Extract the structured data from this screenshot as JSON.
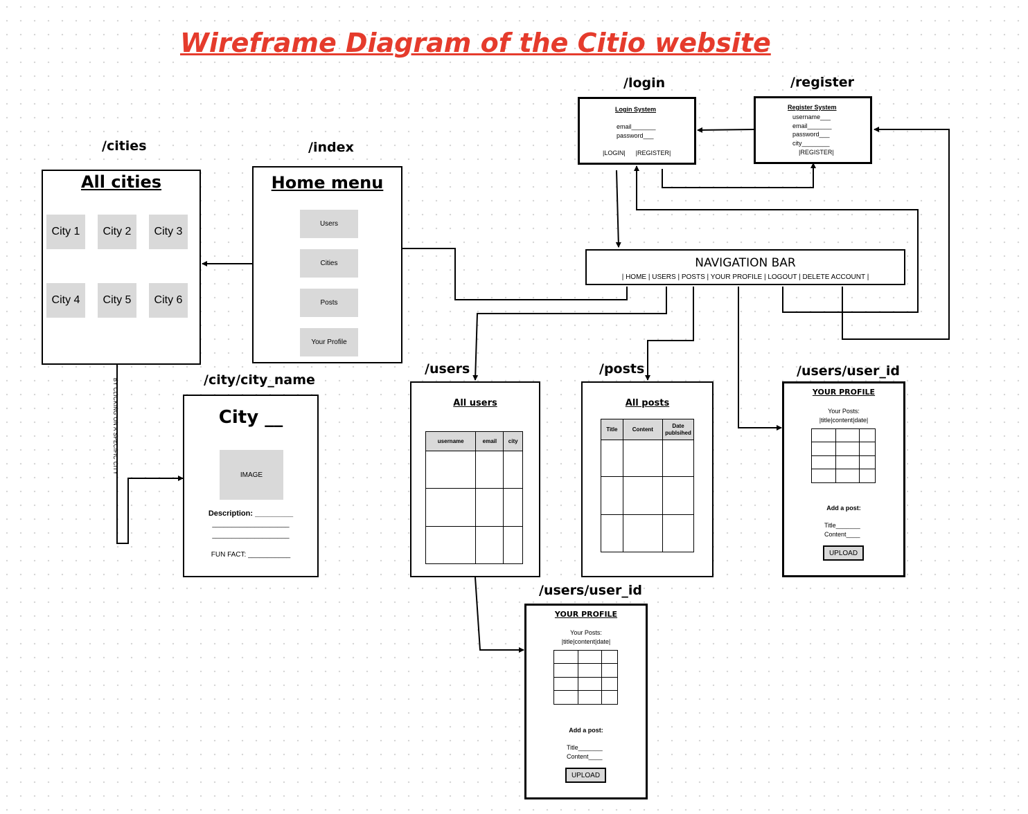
{
  "title": "Wireframe Diagram of the Citio website",
  "routes": {
    "cities": "/cities",
    "index": "/index",
    "login": "/login",
    "register": "/register",
    "city": "/city/city_name",
    "users": "/users",
    "posts": "/posts",
    "user_profile": "/users/user_id",
    "user_profile_2": "/users/user_id"
  },
  "cities_page": {
    "heading": "All cities",
    "tiles": [
      "City 1",
      "City 2",
      "City 3",
      "City 4",
      "City 5",
      "City 6"
    ]
  },
  "home_menu": {
    "heading": "Home menu",
    "buttons": [
      "Users",
      "Cities",
      "Posts",
      "Your Profile"
    ]
  },
  "login": {
    "heading": "Login System",
    "email": "email_______",
    "password": "password___",
    "links": "|LOGIN|      |REGISTER|"
  },
  "register": {
    "heading": "Register System",
    "username": "username___",
    "email": "email_______",
    "password": "password___",
    "city": "city________",
    "link": "|REGISTER|"
  },
  "nav_bar": {
    "heading": "NAVIGATION BAR",
    "items": "| HOME | USERS | POSTS | YOUR PROFILE | LOGOUT | DELETE ACCOUNT |"
  },
  "city_page": {
    "heading": "City __",
    "image": "IMAGE",
    "description": "Description: _________",
    "desc_line_1": "____________________",
    "desc_line_2": "____________________",
    "fun_fact": "FUN FACT: ___________"
  },
  "annotation": "BY CLICKING ON A SPECIFIC CITY",
  "users_page": {
    "heading": "All users",
    "columns": [
      "username",
      "email",
      "city"
    ]
  },
  "posts_page": {
    "heading": "All posts",
    "columns": [
      "Title",
      "Content",
      "Date publsihed"
    ]
  },
  "profile": {
    "heading": "YOUR PROFILE",
    "your_posts": "Your Posts:",
    "posts_cols": "|title|content|date|",
    "add_post": "Add a post:",
    "title_field": "Title_______",
    "content_field": "Content____",
    "upload": "UPLOAD"
  }
}
